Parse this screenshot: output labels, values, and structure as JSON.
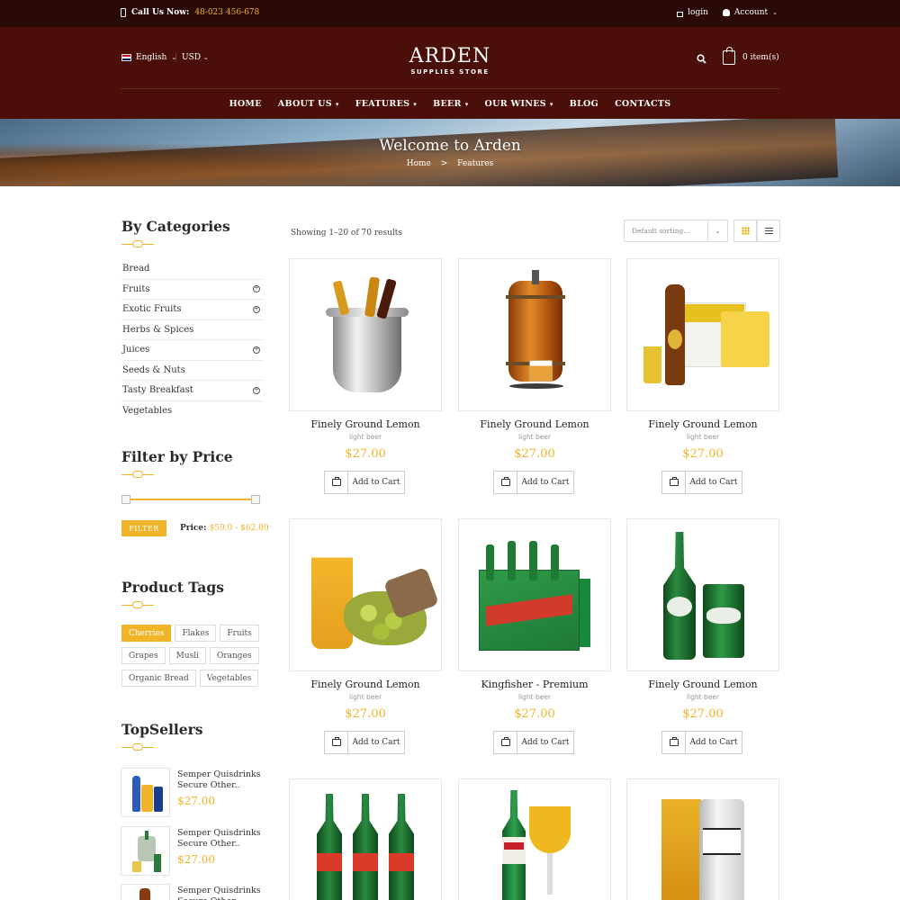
{
  "topbar": {
    "call_label": "Call Us Now:",
    "phone": "48-023 456-678",
    "login": "login",
    "account": "Account"
  },
  "header": {
    "language": "English",
    "currency": "USD",
    "logo_name": "ARDEN",
    "logo_sub": "SUPPLIES STORE",
    "cart_count": "0 item(s)"
  },
  "nav": [
    {
      "label": "HOME"
    },
    {
      "label": "ABOUT US"
    },
    {
      "label": "FEATURES"
    },
    {
      "label": "BEER"
    },
    {
      "label": "OUR WINES"
    },
    {
      "label": "BLOG"
    },
    {
      "label": "CONTACTS"
    }
  ],
  "banner": {
    "title": "Welcome to Arden",
    "crumb_home": "Home",
    "crumb_sep": ">",
    "crumb_current": "Features"
  },
  "sidebar": {
    "categories_title": "By Categories",
    "categories": [
      {
        "label": "Bread",
        "expandable": false
      },
      {
        "label": "Fruits",
        "expandable": true
      },
      {
        "label": "Exotic Fruits",
        "expandable": true
      },
      {
        "label": "Herbs & Spices",
        "expandable": false
      },
      {
        "label": "Juices",
        "expandable": true
      },
      {
        "label": "Seeds & Nuts",
        "expandable": false
      },
      {
        "label": "Tasty Breakfast",
        "expandable": true
      },
      {
        "label": "Vegetables",
        "expandable": false
      }
    ],
    "price_title": "Filter by Price",
    "filter_label": "FILTER",
    "price_label": "Price:",
    "price_min": "$59.0",
    "price_sep": " - ",
    "price_max": "$62.00",
    "tags_title": "Product Tags",
    "tags": [
      "Cherries",
      "Flakes",
      "Fruits",
      "Grapes",
      "Musli",
      "Oranges",
      "Organic Bread",
      "Vegetables"
    ],
    "active_tag": "Cherries",
    "topsellers_title": "TopSellers",
    "topsellers": [
      {
        "name": "Semper Quisdrinks Secure Other..",
        "price": "$27.00"
      },
      {
        "name": "Semper Quisdrinks Secure Other..",
        "price": "$27.00"
      },
      {
        "name": "Semper Quisdrinks Secure Other..",
        "price": ""
      }
    ]
  },
  "shop": {
    "showing": "Showing 1–20 of 70 results",
    "sort_value": "Default sorting...",
    "add_to_cart": "Add to Cart",
    "products": [
      {
        "title": "Finely Ground Lemon",
        "subtitle": "light beer",
        "price": "$27.00"
      },
      {
        "title": "Finely Ground Lemon",
        "subtitle": "light beer",
        "price": "$27.00"
      },
      {
        "title": "Finely Ground Lemon",
        "subtitle": "light beer",
        "price": "$27.00"
      },
      {
        "title": "Finely Ground Lemon",
        "subtitle": "light beer",
        "price": "$27.00"
      },
      {
        "title": "Kingfisher - Premium",
        "subtitle": "light beer",
        "price": "$27.00"
      },
      {
        "title": "Finely Ground Lemon",
        "subtitle": "light beer",
        "price": "$27.00"
      }
    ]
  },
  "colors": {
    "accent": "#f0b429",
    "topbar": "#2a0a06",
    "header": "#4a0f08"
  }
}
